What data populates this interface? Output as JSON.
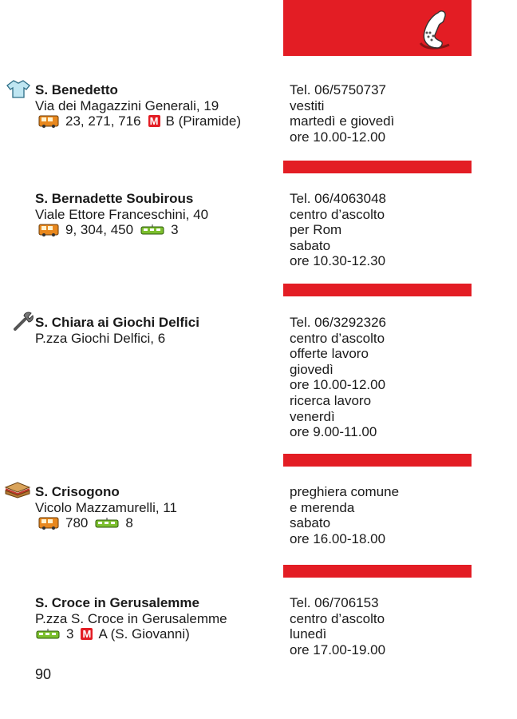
{
  "page_number": "90",
  "colors": {
    "accent_red": "#e31d24",
    "bus_orange": "#e8881e",
    "tram_green": "#7cbf2e"
  },
  "icons": {
    "header": "telephone-icon",
    "transport": [
      "bus-icon",
      "metro-icon",
      "tram-icon"
    ]
  },
  "entries": [
    {
      "category_icon": "clothes-shirt-icon",
      "name": "S. Benedetto",
      "address": "Via dei Magazzini Generali, 19",
      "bus": "23, 271, 716",
      "metro_label": "M",
      "metro": "B (Piramide)",
      "info": [
        "Tel. 06/5750737",
        "vestiti",
        "martedì e giovedì",
        "ore 10.00-12.00"
      ]
    },
    {
      "name": "S. Bernadette Soubirous",
      "address": "Viale Ettore Franceschini, 40",
      "bus": "9, 304, 450",
      "tram": "3",
      "info": [
        "Tel. 06/4063048",
        "centro d’ascolto",
        "per Rom",
        "sabato",
        "ore 10.30-12.30"
      ]
    },
    {
      "category_icon": "wrench-icon",
      "name": "S. Chiara ai Giochi Delfici",
      "address": "P.zza Giochi Delfici, 6",
      "info": [
        "Tel. 06/3292326",
        "centro d’ascolto",
        "offerte lavoro",
        "giovedì",
        "ore 10.00-12.00",
        "ricerca lavoro",
        "venerdì",
        "ore 9.00-11.00"
      ]
    },
    {
      "category_icon": "sandwich-icon",
      "name": "S. Crisogono",
      "address": "Vicolo Mazzamurelli, 11",
      "bus": "780",
      "tram": "8",
      "info": [
        "preghiera comune",
        "e merenda",
        "sabato",
        "ore 16.00-18.00"
      ]
    },
    {
      "name": "S. Croce in Gerusalemme",
      "address": "P.zza S. Croce in Gerusalemme",
      "tram": "3",
      "metro_label": "M",
      "metro": "A (S. Giovanni)",
      "info": [
        "Tel. 06/706153",
        "centro d’ascolto",
        "lunedì",
        "ore 17.00-19.00"
      ]
    }
  ]
}
